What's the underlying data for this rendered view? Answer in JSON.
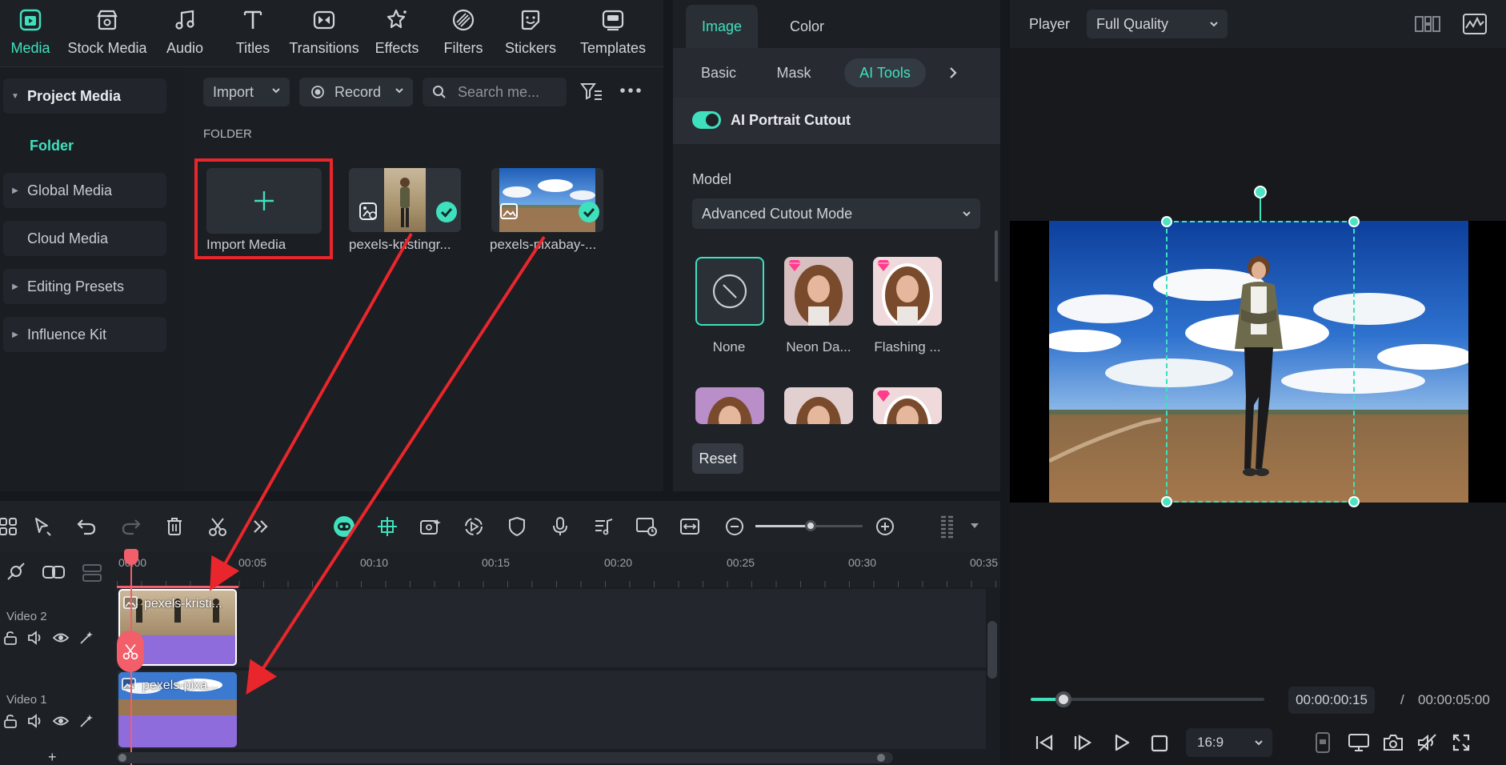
{
  "toolbar": {
    "items": [
      {
        "label": "Media",
        "icon": "media-icon",
        "active": true
      },
      {
        "label": "Stock Media",
        "icon": "stock-media-icon"
      },
      {
        "label": "Audio",
        "icon": "audio-icon"
      },
      {
        "label": "Titles",
        "icon": "titles-icon"
      },
      {
        "label": "Transitions",
        "icon": "transitions-icon"
      },
      {
        "label": "Effects",
        "icon": "effects-icon"
      },
      {
        "label": "Filters",
        "icon": "filters-icon"
      },
      {
        "label": "Stickers",
        "icon": "stickers-icon"
      },
      {
        "label": "Templates",
        "icon": "templates-icon"
      }
    ]
  },
  "sidebar": {
    "project_media": "Project Media",
    "folder": "Folder",
    "global_media": "Global Media",
    "cloud_media": "Cloud Media",
    "editing_presets": "Editing Presets",
    "influence_kit": "Influence Kit"
  },
  "media": {
    "import_label": "Import",
    "record_label": "Record",
    "search_placeholder": "Search me...",
    "folder_heading": "FOLDER",
    "import_media_label": "Import Media",
    "tiles": [
      {
        "label": "pexels-kristingr...",
        "kind": "video",
        "checked": true
      },
      {
        "label": "pexels-pixabay-...",
        "kind": "image",
        "checked": true
      }
    ]
  },
  "props": {
    "tabs": [
      "Image",
      "Color"
    ],
    "active_tab": "Image",
    "subtabs": [
      "Basic",
      "Mask",
      "AI Tools"
    ],
    "active_subtab": "AI Tools",
    "ai_portrait_label": "AI Portrait Cutout",
    "ai_portrait_on": true,
    "model_label": "Model",
    "model_value": "Advanced Cutout Mode",
    "presets": [
      {
        "label": "None",
        "selected": true
      },
      {
        "label": "Neon Da...",
        "premium": true
      },
      {
        "label": "Flashing ...",
        "premium": true
      }
    ],
    "reset_label": "Reset"
  },
  "player": {
    "label": "Player",
    "quality": "Full Quality",
    "current_time": "00:00:00:15",
    "separator": "/",
    "total_time": "00:00:05:00",
    "aspect_ratio": "16:9",
    "progress": 0.14
  },
  "timeline": {
    "ruler": [
      "00:00",
      "00:05",
      "00:10",
      "00:15",
      "00:20",
      "00:25",
      "00:30",
      "00:35"
    ],
    "tracks": [
      {
        "name": "Video 2",
        "clip_label": "pexels-kristi..."
      },
      {
        "name": "Video 1",
        "clip_label": "pexels-pixa..."
      }
    ],
    "add_label": "+"
  },
  "colors": {
    "accent": "#3fe0bd",
    "annotation_red": "#e8262b",
    "clip_purple": "#8e6cdc",
    "playhead": "#f25e6a"
  }
}
